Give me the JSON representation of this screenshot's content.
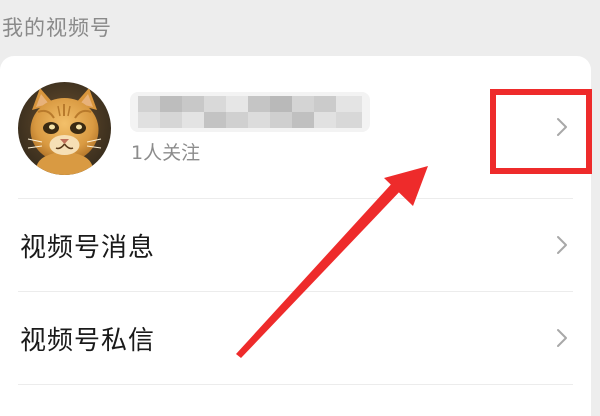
{
  "section": {
    "title": "我的视频号"
  },
  "profile": {
    "name_obscured": true,
    "follow_text": "1人关注",
    "avatar_icon": "cat-avatar-icon",
    "chevron_icon": "chevron-right-icon"
  },
  "menu": {
    "messages_label": "视频号消息",
    "dm_label": "视频号私信",
    "chevron_icon": "chevron-right-icon"
  },
  "annotation": {
    "highlight_color": "#ee2b2b",
    "arrow_color": "#ee2b2b"
  },
  "colors": {
    "background": "#ededed",
    "card": "#ffffff",
    "secondary_text": "#8c8c8c",
    "primary_text": "#1a1a1a"
  }
}
